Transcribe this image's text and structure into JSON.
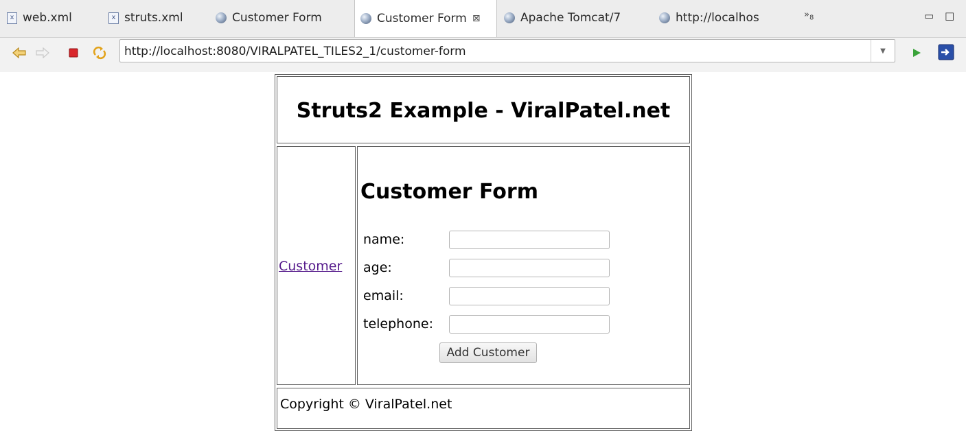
{
  "tabs": [
    {
      "label": "web.xml",
      "icon": "xml-file-icon"
    },
    {
      "label": "struts.xml",
      "icon": "xml-file-icon"
    },
    {
      "label": "Customer Form",
      "icon": "globe-icon"
    },
    {
      "label": "Customer Form",
      "icon": "globe-icon",
      "active": true,
      "close": "⊠"
    },
    {
      "label": "Apache Tomcat/7",
      "icon": "globe-icon"
    },
    {
      "label": "http://localhos",
      "icon": "globe-icon"
    }
  ],
  "overflow": {
    "glyph": "»",
    "count": "8"
  },
  "window_buttons": {
    "minimize": "▭",
    "maximize": "□"
  },
  "toolbar": {
    "url": "http://localhost:8080/VIRALPATEL_TILES2_1/customer-form",
    "dropdown": "▼"
  },
  "page": {
    "header_title": "Struts2 Example - ViralPatel.net",
    "menu_link": "Customer",
    "form_title": "Customer Form",
    "fields": [
      {
        "label": "name:",
        "value": ""
      },
      {
        "label": "age:",
        "value": ""
      },
      {
        "label": "email:",
        "value": ""
      },
      {
        "label": "telephone:",
        "value": ""
      }
    ],
    "submit_label": "Add Customer",
    "footer": "Copyright © ViralPatel.net"
  },
  "colors": {
    "link_visited": "#551a8b",
    "stop_red": "#d9262b",
    "go_green": "#3aa33a"
  }
}
